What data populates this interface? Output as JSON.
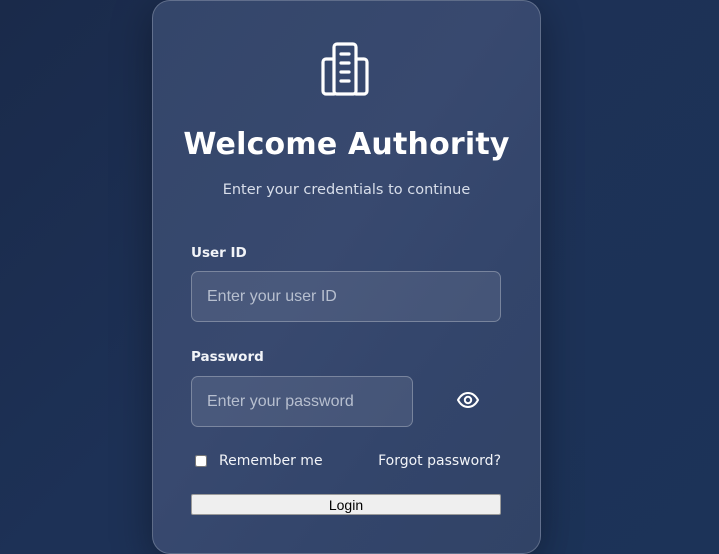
{
  "header": {
    "logo_icon": "building-icon",
    "title": "Welcome Authority",
    "subtitle": "Enter your credentials to continue"
  },
  "form": {
    "user_id": {
      "label": "User ID",
      "placeholder": "Enter your user ID",
      "value": ""
    },
    "password": {
      "label": "Password",
      "placeholder": "Enter your password",
      "value": "",
      "toggle_icon": "eye-icon"
    },
    "remember_me": {
      "label": "Remember me",
      "checked": false
    },
    "forgot_password": "Forgot password?",
    "login_label": "Login"
  },
  "colors": {
    "background": "#1c2f52",
    "card": "#36486d",
    "text": "#ffffff"
  }
}
